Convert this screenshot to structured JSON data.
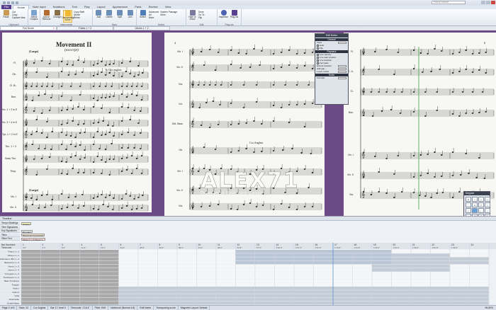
{
  "titlebar": {
    "title": "",
    "search_placeholder": "Find in ribbon"
  },
  "ribbon_tabs": {
    "file": "File",
    "tabs": [
      "Home",
      "Note Input",
      "Notations",
      "Text",
      "Play",
      "Layout",
      "Appearance",
      "Parts",
      "Review",
      "View"
    ],
    "active_index": 0
  },
  "ribbon": {
    "groups": [
      {
        "label": "Clipboard",
        "buttons": [
          "Paste"
        ],
        "small": [
          "Cut",
          "Copy",
          "Capture Idea"
        ]
      },
      {
        "label": "",
        "buttons": [
          "Select Graphic"
        ],
        "small": []
      },
      {
        "label": "Instruments",
        "buttons": [
          "Add or Remove",
          "Change",
          "Transposing Score"
        ],
        "small": [
          "Copy Staff",
          "Above",
          "Below"
        ]
      },
      {
        "label": "Bars",
        "buttons": [
          "Add",
          "Delete",
          "Split",
          "Join"
        ],
        "small": []
      },
      {
        "label": "Select",
        "buttons": [
          "Select"
        ],
        "small": [
          "Advanced",
          "All",
          "More",
          "System Passage",
          "None"
        ]
      },
      {
        "label": "Edit",
        "buttons": [
          "Hide or Show"
        ],
        "small": [
          "Done",
          "Go To",
          "Flip"
        ]
      },
      {
        "label": "Plug-ins",
        "buttons": [
          "Inspector",
          "Plug-ins"
        ],
        "small": []
      }
    ]
  },
  "doc_tabs": [
    {
      "label": "Full Score",
      "active": true,
      "closable": true
    },
    {
      "label": "Flutes 1 + 2",
      "active": false,
      "closable": false
    },
    {
      "label": "Oboes 1 + 2",
      "active": false,
      "closable": false
    }
  ],
  "score": {
    "page1": {
      "title": "Movement II",
      "subtitle": "(excerpt)",
      "tempo": "(Largo)",
      "tempo2": "(Largo)",
      "instruments": [
        "Fl.",
        "Ob.",
        "Cl. B♭",
        "Bsn.",
        "Hn. 1 + 2 in E",
        "Hn. 3 + 4 in E",
        "Tpt. 1 + 2 in E",
        "Tbn. 1 + 2",
        "Bass Tbn.",
        "Timp.",
        "Vln. I",
        "Vln. II"
      ],
      "annotations": [
        "To Cor anglais",
        "pp"
      ]
    },
    "page2": {
      "page_number": "4",
      "instruments": [
        "Vln. I",
        "Vln. II",
        "Vla.",
        "Vcl.",
        "Dbl. Bass",
        "Ob.",
        "Vln. I",
        "Vln. II",
        "Vla."
      ],
      "annotations": [
        "Cor Anglais",
        "p"
      ]
    },
    "page3": {
      "page_number": "5",
      "instruments": [
        "Fl.",
        "C. A.",
        "Cl.",
        "Bsn.",
        "Vln. I",
        "Vln. II",
        "Vla."
      ]
    }
  },
  "watermark": {
    "big": "ALEX71",
    "small": "Download Software Gratis"
  },
  "edit_panel": {
    "title": "Edit Notes",
    "sections": [
      "General",
      "Playback",
      "Notes"
    ],
    "rows": [
      "Voice",
      "Hide",
      "Flip",
      "Live velocity",
      "Live start position",
      "Live duration",
      "Fermatas",
      "Extend duration",
      "Add gap –",
      "Fermata"
    ],
    "bottom_fields": [
      "Leave nodes",
      "Live start"
    ]
  },
  "keypad": {
    "title": "Keypad",
    "keys": [
      "♯",
      "♮",
      "♭",
      "—",
      "·",
      "∧",
      ">",
      "•",
      "♪",
      "♩",
      "♩.",
      "𝅗𝅥",
      "𝅝",
      "7",
      "8",
      "9",
      "4",
      "5",
      "6",
      "."
    ]
  },
  "timeline": {
    "header": "Timeline",
    "rows": [
      {
        "name": "Tempo Markings",
        "chips": [
          {
            "label": "(Largo)",
            "color": "#f7f3c2"
          }
        ]
      },
      {
        "name": "Time Signatures",
        "chips": []
      },
      {
        "name": "Key Signatures",
        "chips": [
          {
            "label": "Eb major",
            "color": "#e9e9e9"
          }
        ]
      },
      {
        "name": "Titles",
        "chips": [
          {
            "label": "Movement II (excerpt)",
            "color": "#f1e3c9"
          }
        ]
      },
      {
        "name": "Other Text",
        "chips": [
          {
            "label": "Flutes 1 + 2 Oboes 1...",
            "color": "#f6d5d5"
          }
        ]
      }
    ],
    "bar_numbers": [
      "1",
      "2",
      "3",
      "4",
      "5",
      "6",
      "7",
      "8",
      "9",
      "10",
      "11",
      "12",
      "13",
      "14",
      "15",
      "16",
      "17",
      "18",
      "19",
      "20",
      "21",
      "22",
      "23",
      "24"
    ],
    "timecodes": [
      "0.0\"",
      "6.0\"",
      "9.0\"",
      "14.4\"",
      "19.2\"",
      "24.0\"",
      "28.8\"",
      "33.6\"",
      "38.4\"",
      "43.2\"",
      "48.0\"",
      "52.8\"",
      "57.6\"",
      "1'02.4\"",
      "1'07.2\"",
      "1'12.0\"",
      "1'16.8\"",
      "1'21.6\"",
      "1'26.4\"",
      "1'31.2\"",
      "1'36.0\"",
      "1'40.8\"",
      "1'45.6\""
    ],
    "instruments": [
      "Flutes 1 + 2",
      "Oboes 1 + 2",
      "Clarinets in Bb 1 + 2",
      "Bassoons 1 + 2",
      "Horns 1 + 2",
      "Horns 3 + 4",
      "Trumpets 1 + 2",
      "Trombones 1 + 2",
      "Bass Trombone",
      "Timpani",
      "Violin I",
      "Violin II",
      "Viola",
      "Violoncello",
      "Double Bass"
    ],
    "marker": "1 4"
  },
  "status": {
    "items": [
      "Page 2 of 6",
      "Bars: 24",
      "Cor Anglais",
      "Bar 17, beat 3",
      "Timecode: 1'16.4\"",
      "Pitch: Eb5",
      "Notebook (Normal 1/4)",
      "Edit Notes",
      "Transposing score",
      "Magnetic Layout: Default"
    ],
    "zoom": "95.80%"
  },
  "colors": {
    "accent": "#5a3e8e",
    "score_bg": "#6b4a86",
    "highlight": "#f0b830"
  }
}
